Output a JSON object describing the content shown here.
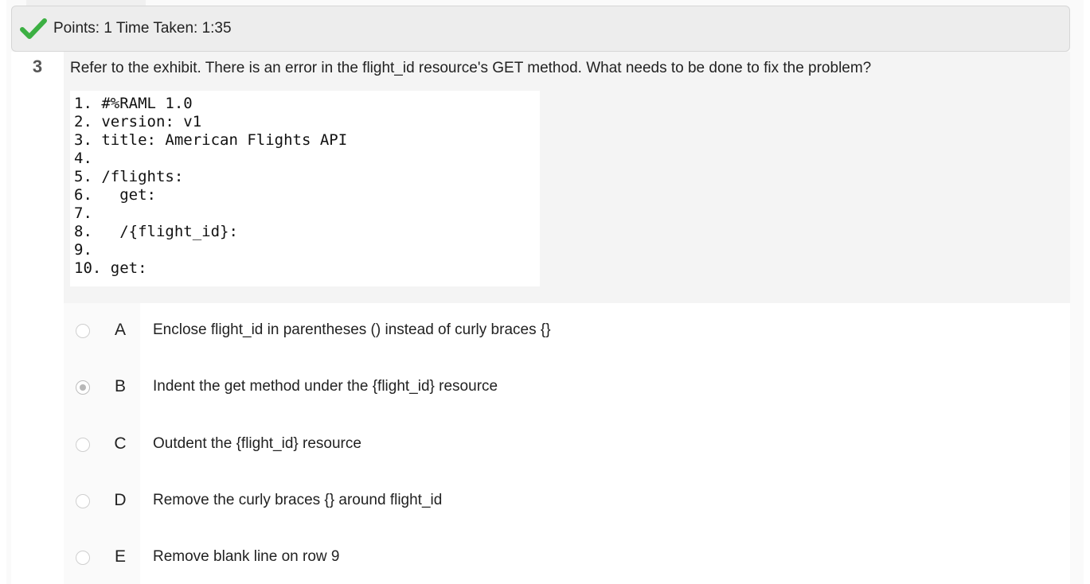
{
  "result": {
    "points_label": "Points: 1 Time Taken: 1:35",
    "status_icon": "checkmark-icon",
    "status_color": "#3cb043"
  },
  "question": {
    "number": "3",
    "text": "Refer to the exhibit. There is an error in the flight_id resource's GET method. What needs to be done to fix the problem?",
    "exhibit_lines": [
      "1. #%RAML 1.0",
      "2. version: v1",
      "3. title: American Flights API",
      "4.",
      "5. /flights:",
      "6.   get:",
      "7.",
      "8.   /{flight_id}:",
      "9.",
      "10. get:"
    ]
  },
  "options": [
    {
      "letter": "A",
      "text": "Enclose flight_id in parentheses () instead of curly braces {}",
      "selected": false
    },
    {
      "letter": "B",
      "text": "Indent the get method under the {flight_id} resource",
      "selected": true
    },
    {
      "letter": "C",
      "text": "Outdent the {flight_id} resource",
      "selected": false
    },
    {
      "letter": "D",
      "text": "Remove the curly braces {} around flight_id",
      "selected": false
    },
    {
      "letter": "E",
      "text": "Remove blank line on row 9",
      "selected": false
    }
  ]
}
